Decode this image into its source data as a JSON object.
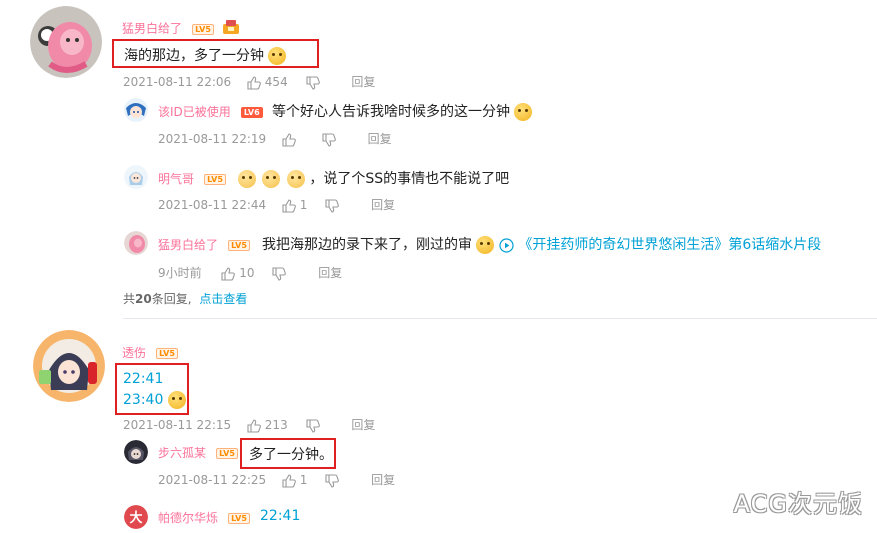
{
  "thread1": {
    "author": "猛男白给了",
    "text": "海的那边，多了一分钟",
    "date": "2021-08-11 22:06",
    "likes": "454",
    "reply_label": "回复",
    "replies": [
      {
        "author": "该ID已被使用",
        "level": "LV6",
        "text": "等个好心人告诉我啥时候多的这一分钟",
        "date": "2021-08-11 22:19",
        "likes": "",
        "reply_label": "回复"
      },
      {
        "author": "明气哥",
        "level": "LV5",
        "text": "，说了个SS的事情也不能说了吧",
        "date": "2021-08-11 22:44",
        "likes": "1",
        "reply_label": "回复"
      },
      {
        "author": "猛男白给了",
        "level": "LV5",
        "text": "我把海那边的录下来了，刚过的审",
        "link": "《开挂药师的奇幻世界悠闲生活》第6话缩水片段",
        "date": "9小时前",
        "likes": "10",
        "reply_label": "回复"
      }
    ],
    "total_prefix": "共",
    "total_count": "20",
    "total_suffix": "条回复,",
    "view_more": "点击查看"
  },
  "thread2": {
    "author": "透伤",
    "level": "LV5",
    "line1": "22:41",
    "line2": "23:40",
    "date": "2021-08-11 22:15",
    "likes": "213",
    "reply_label": "回复",
    "replies": [
      {
        "author": "步六孤某",
        "level": "LV5",
        "text": "多了一分钟。",
        "date": "2021-08-11 22:25",
        "likes": "1",
        "reply_label": "回复"
      },
      {
        "author": "帕德尔华烁",
        "level": "LV5",
        "text": "22:41"
      }
    ]
  },
  "watermark": "ACG次元饭",
  "colors": {
    "username": "#fb7299",
    "link": "#00a1d6",
    "highlight_box": "#e02020",
    "meta": "#999999"
  }
}
